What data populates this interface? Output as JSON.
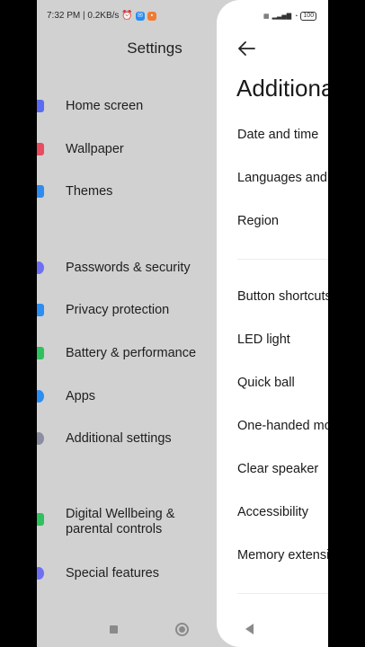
{
  "status_bar": {
    "time_speed": "7:32 PM | 0.2KB/s",
    "battery": "100"
  },
  "settings": {
    "title": "Settings",
    "items": [
      {
        "label": "Home screen",
        "icon": "home-icon",
        "color": "#5b6cf0"
      },
      {
        "label": "Wallpaper",
        "icon": "wallpaper-icon",
        "color": "#e94b5f"
      },
      {
        "label": "Themes",
        "icon": "themes-icon",
        "color": "#2d8cf0"
      },
      {
        "label": "Passwords & security",
        "icon": "fingerprint-icon",
        "color": "#6f6ff5"
      },
      {
        "label": "Privacy protection",
        "icon": "shield-icon",
        "color": "#2c8df2"
      },
      {
        "label": "Battery & performance",
        "icon": "battery-icon",
        "color": "#2fc15e"
      },
      {
        "label": "Apps",
        "icon": "gear-icon",
        "color": "#2c8df2"
      },
      {
        "label": "Additional settings",
        "icon": "more-icon",
        "color": "#8a8ea0"
      },
      {
        "label": "Digital Wellbeing & parental controls",
        "icon": "wellbeing-icon",
        "color": "#2fc15e"
      },
      {
        "label": "Special features",
        "icon": "features-icon",
        "color": "#6f6ff5"
      }
    ]
  },
  "additional": {
    "title": "Additional settings",
    "items": [
      "Date and time",
      "Languages and input",
      "Region",
      "Button shortcuts",
      "LED light",
      "Quick ball",
      "One-handed mode",
      "Clear speaker",
      "Accessibility",
      "Memory extension"
    ]
  }
}
